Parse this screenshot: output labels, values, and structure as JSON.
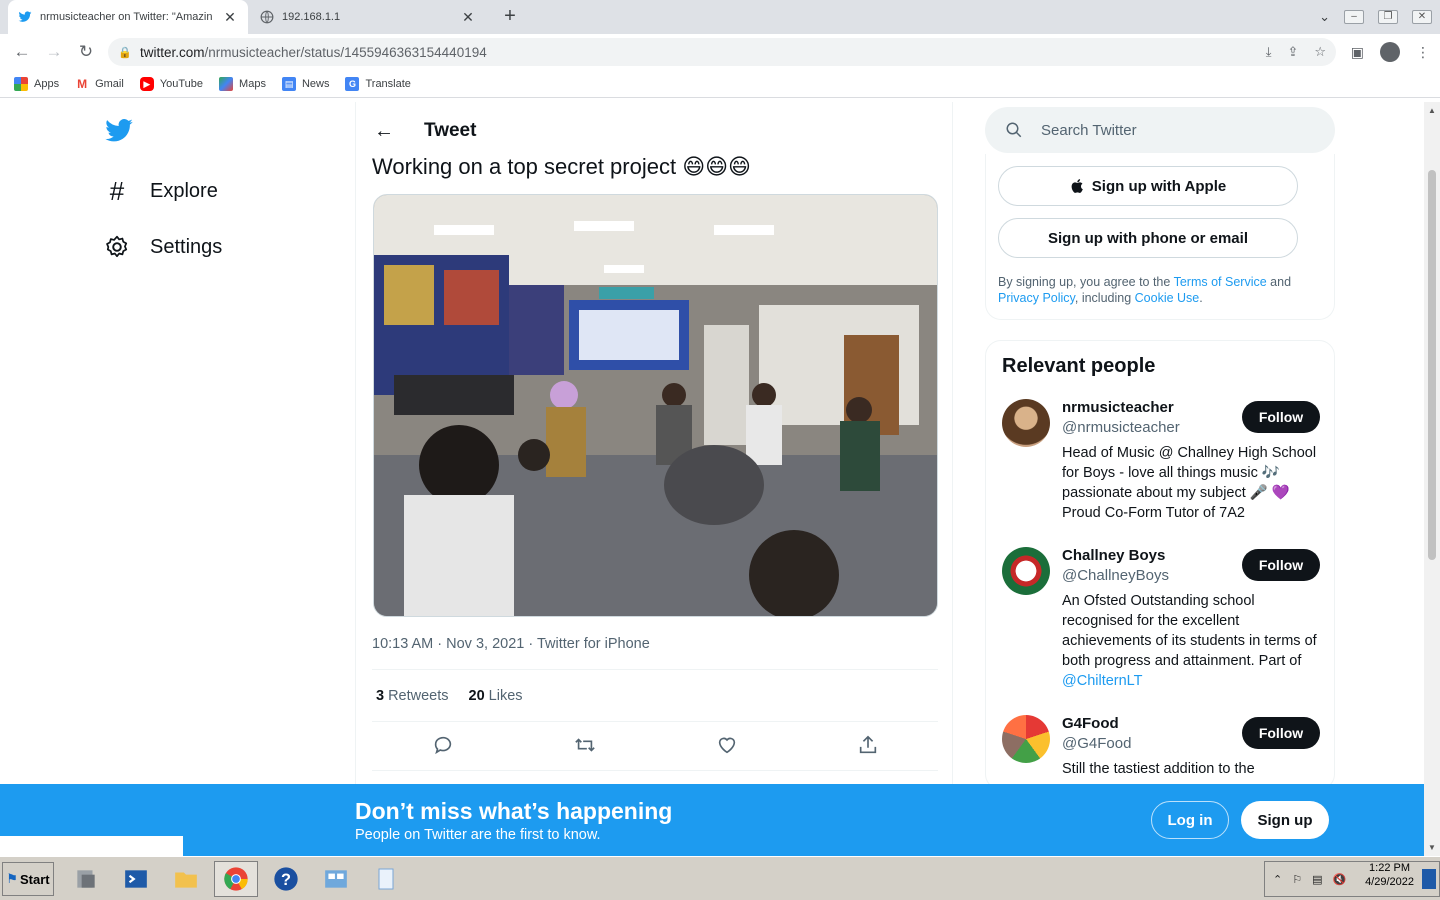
{
  "browser": {
    "tabs": [
      {
        "title": "nrmusicteacher on Twitter: \"Amazin",
        "active": true,
        "icon": "twitter-bird-icon"
      },
      {
        "title": "192.168.1.1",
        "active": false,
        "icon": "globe-icon"
      }
    ],
    "url_host": "twitter.com",
    "url_path": "/nrmusicteacher/status/1455946363154440194",
    "bookmarks": [
      {
        "label": "Apps",
        "icon": "apps-grid-icon"
      },
      {
        "label": "Gmail",
        "icon": "gmail-icon"
      },
      {
        "label": "YouTube",
        "icon": "youtube-icon"
      },
      {
        "label": "Maps",
        "icon": "maps-icon"
      },
      {
        "label": "News",
        "icon": "news-icon"
      },
      {
        "label": "Translate",
        "icon": "translate-icon"
      }
    ]
  },
  "sidebar": {
    "items": [
      {
        "label": "Explore",
        "icon": "hashtag-icon"
      },
      {
        "label": "Settings",
        "icon": "gear-icon"
      }
    ]
  },
  "tweet": {
    "header_title": "Tweet",
    "text": "Working on a top secret project 😄😄😄",
    "meta": "10:13 AM · Nov 3, 2021 · Twitter for iPhone",
    "retweets_count": "3",
    "retweets_label": "Retweets",
    "likes_count": "20",
    "likes_label": "Likes"
  },
  "right_panel": {
    "search_placeholder": "Search Twitter",
    "signup_apple": "Sign up with Apple",
    "signup_phone": "Sign up with phone or email",
    "legal": {
      "prefix": "By signing up, you agree to the ",
      "terms": "Terms of Service",
      "and": " and ",
      "privacy": "Privacy Policy",
      "including": ", including ",
      "cookie": "Cookie Use",
      "end": "."
    },
    "relevant_title": "Relevant people",
    "people": [
      {
        "name": "nrmusicteacher",
        "handle": "@nrmusicteacher",
        "bio": "Head of Music @ Challney High School for Boys - love all things music 🎶 passionate about my subject 🎤 💜 Proud Co-Form Tutor of 7A2",
        "follow": "Follow"
      },
      {
        "name": "Challney Boys",
        "handle": "@ChallneyBoys",
        "bio": "An Ofsted Outstanding school recognised for the excellent achievements of its students in terms of both progress and attainment. Part of ",
        "bio_link": "@ChilternLT",
        "follow": "Follow"
      },
      {
        "name": "G4Food",
        "handle": "@G4Food",
        "bio": "Still the tastiest addition to the",
        "follow": "Follow"
      }
    ]
  },
  "banner": {
    "title": "Don’t miss what’s happening",
    "subtitle": "People on Twitter are the first to know.",
    "login": "Log in",
    "signup": "Sign up"
  },
  "taskbar": {
    "start": "Start",
    "time": "1:22 PM",
    "date": "4/29/2022"
  },
  "colors": {
    "twitter_blue": "#1d9bf0",
    "text_primary": "#0f1419",
    "text_secondary": "#536471"
  }
}
